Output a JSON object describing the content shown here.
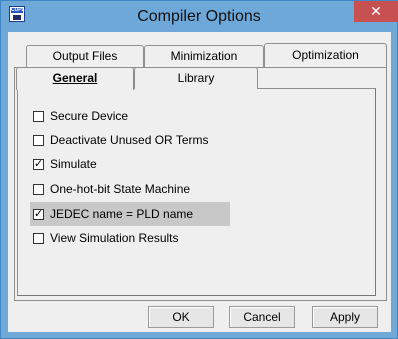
{
  "window": {
    "title": "Compiler Options",
    "close": "✕",
    "icon": "CUPL"
  },
  "tabs": {
    "back_row": [
      "Output Files",
      "Minimization",
      "Optimization"
    ],
    "front_row": [
      "General",
      "Library"
    ],
    "active": "General"
  },
  "options": [
    {
      "label": "Secure Device",
      "checked": false
    },
    {
      "label": "Deactivate Unused OR Terms",
      "checked": false
    },
    {
      "label": "Simulate",
      "checked": true
    },
    {
      "label": "One-hot-bit State Machine",
      "checked": false
    },
    {
      "label": "JEDEC name = PLD name",
      "checked": true
    },
    {
      "label": "View Simulation Results",
      "checked": false
    }
  ],
  "buttons": {
    "ok": "OK",
    "cancel": "Cancel",
    "apply": "Apply"
  }
}
